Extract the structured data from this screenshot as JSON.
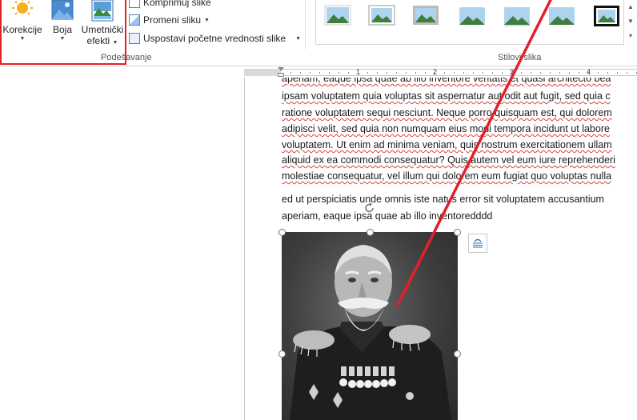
{
  "ribbon": {
    "adjust": {
      "korekcije": "Korekcije",
      "boja": "Boja",
      "umetnicki_line1": "Umetnički",
      "umetnicki_line2": "efekti",
      "group_label": "Podešavanje"
    },
    "small": {
      "komprimuj": "Komprimuj slike",
      "promeni": "Promeni sliku",
      "uspostavi": "Uspostavi početne vrednosti slike"
    },
    "styles": {
      "group_label": "Stilovi slika"
    }
  },
  "ruler": {
    "numbers": [
      "1",
      "2",
      "3",
      "4"
    ]
  },
  "document": {
    "paragraph1": [
      "aperiam, eaque ipsa quae ab illo inventore veritatis et quasi architecto bea",
      "ipsam voluptatem quia voluptas sit aspernatur aut odit aut fugit, sed quia c",
      "ratione voluptatem sequi nesciunt. Neque porro quisquam est, qui dolorem",
      "adipisci velit, sed quia non numquam eius modi tempora incidunt ut labore",
      "voluptatem. Ut enim ad minima veniam, quis nostrum exercitationem ullam",
      "aliquid ex ea commodi consequatur? Quis autem vel eum iure reprehenderi",
      "molestiae consequatur, vel illum qui dolorem eum fugiat quo voluptas nulla"
    ],
    "paragraph2": [
      "ed ut perspiciatis unde omnis iste natus error sit voluptatem accusantium",
      "aperiam, eaque ipsa quae ab illo inventoredddd"
    ]
  },
  "colors": {
    "annotation_red": "#e02127",
    "spell_red": "#e04040"
  }
}
